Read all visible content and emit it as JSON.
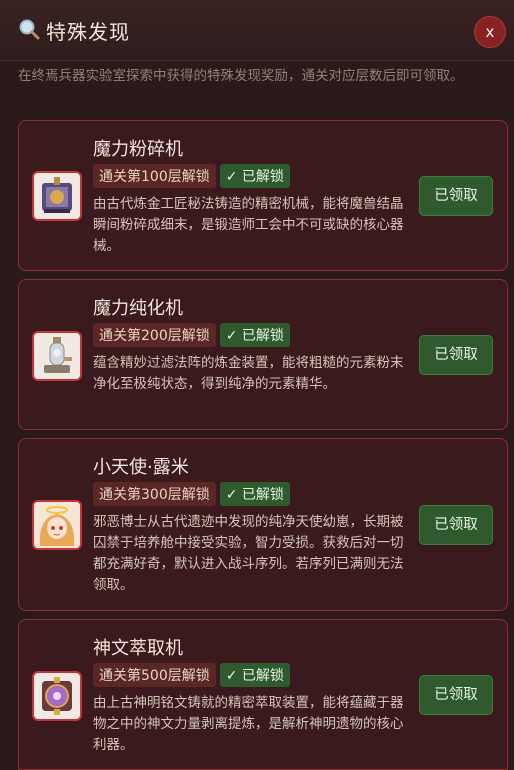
{
  "header": {
    "title": "特殊发现",
    "close_label": "x"
  },
  "description": "在终焉兵器实验室探索中获得的特殊发现奖励，通关对应层数后即可领取。",
  "cards": [
    {
      "title": "魔力粉碎机",
      "floor_badge": "通关第100层解锁",
      "unlock_badge": "✓ 已解锁",
      "body": "由古代炼金工匠秘法铸造的精密机械，能将魔兽结晶瞬间粉碎成细末，是锻造师工会中不可或缺的核心器械。",
      "button": "已领取",
      "icon": "crusher-machine-icon"
    },
    {
      "title": "魔力纯化机",
      "floor_badge": "通关第200层解锁",
      "unlock_badge": "✓ 已解锁",
      "body": "蕴含精妙过滤法阵的炼金装置，能将粗糙的元素粉末净化至极纯状态，得到纯净的元素精华。",
      "button": "已领取",
      "icon": "purifier-machine-icon"
    },
    {
      "title": "小天使·露米",
      "floor_badge": "通关第300层解锁",
      "unlock_badge": "✓ 已解锁",
      "body": "邪恶博士从古代遗迹中发现的纯净天使幼崽，长期被囚禁于培养舱中接受实验，智力受损。获救后对一切都充满好奇，默认进入战斗序列。若序列已满则无法领取。",
      "button": "已领取",
      "icon": "angel-portrait-icon"
    },
    {
      "title": "神文萃取机",
      "floor_badge": "通关第500层解锁",
      "unlock_badge": "✓ 已解锁",
      "body": "由上古神明铭文铸就的精密萃取装置，能将蕴藏于器物之中的神文力量剥离提炼，是解析神明遗物的核心利器。",
      "button": "已领取",
      "icon": "extractor-machine-icon"
    }
  ]
}
